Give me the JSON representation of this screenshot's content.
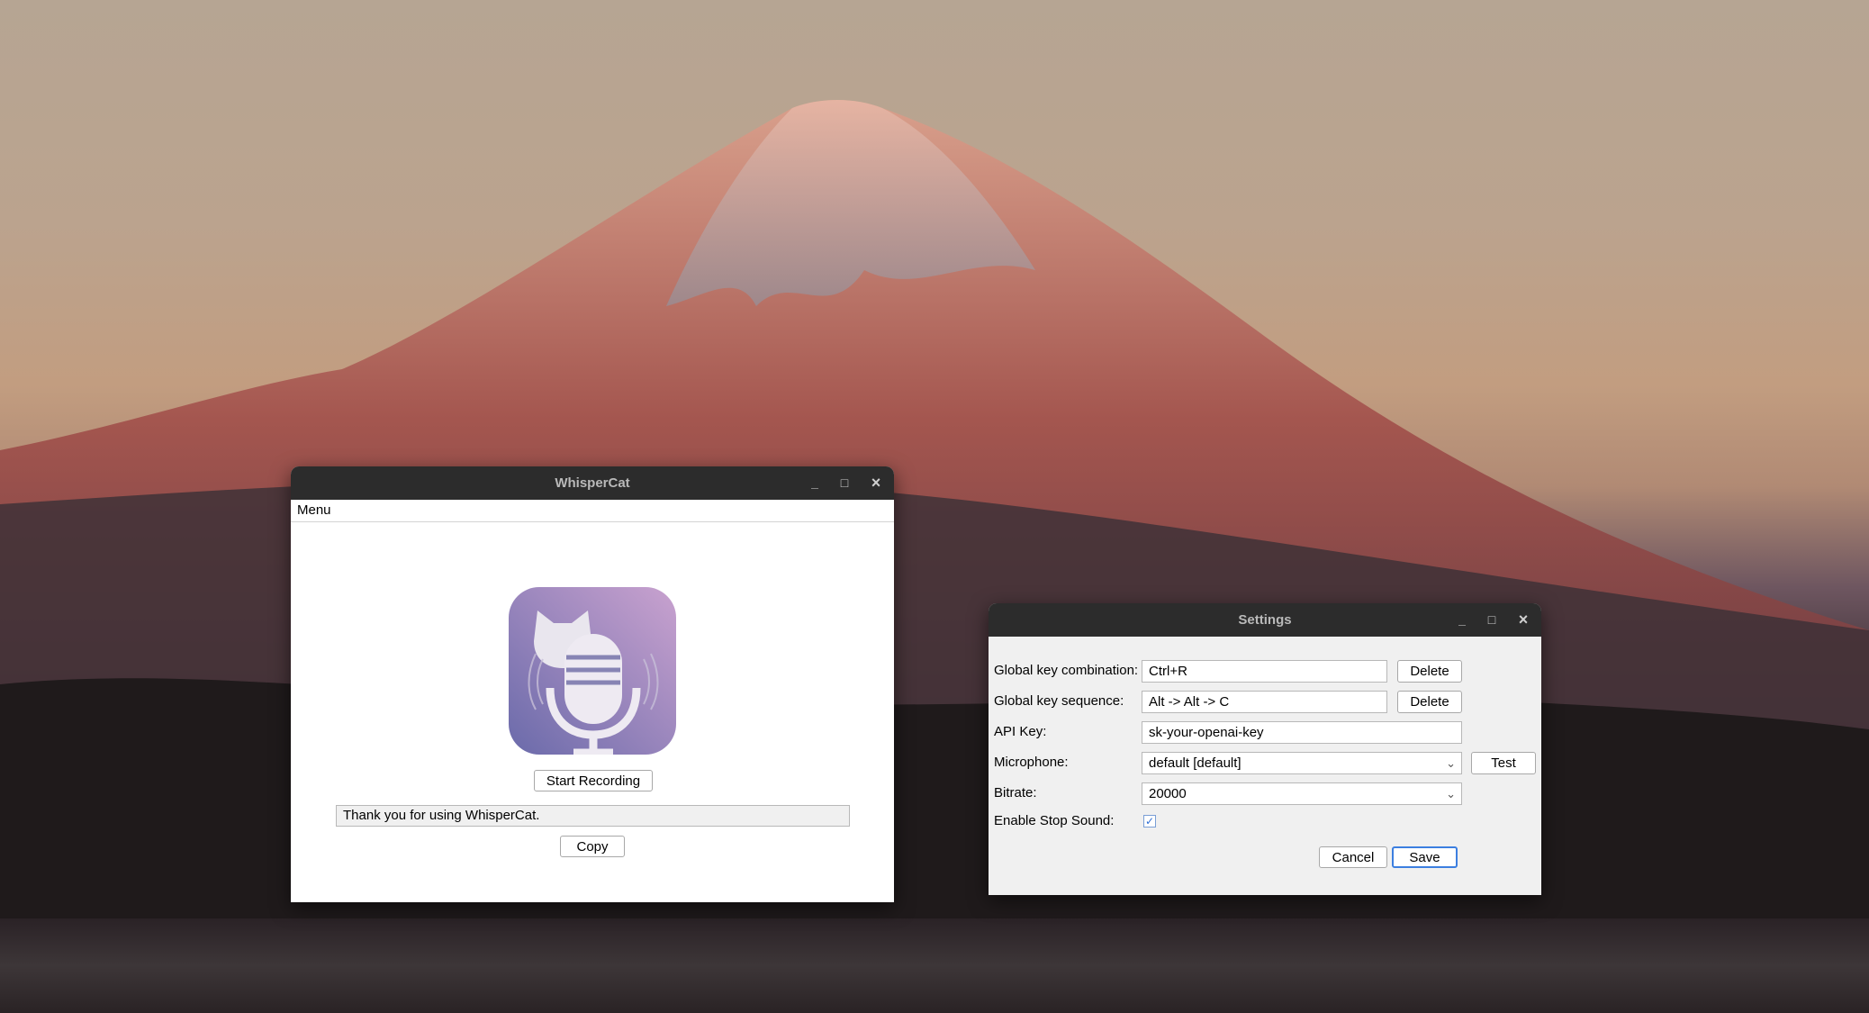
{
  "desktop": {
    "wallpaper": "mountain-at-dusk"
  },
  "main_window": {
    "title": "WhisperCat",
    "controls": {
      "minimize": "_",
      "maximize": "□",
      "close": "×"
    },
    "menu": {
      "label": "Menu"
    },
    "logo": "microphone-cat-logo",
    "record_button": "Start Recording",
    "transcript_text": "Thank you for using WhisperCat.",
    "copy_button": "Copy"
  },
  "settings_window": {
    "title": "Settings",
    "controls": {
      "minimize": "_",
      "maximize": "□",
      "close": "×"
    },
    "rows": {
      "global_key_combination": {
        "label": "Global key combination:",
        "value": "Ctrl+R",
        "button": "Delete"
      },
      "global_key_sequence": {
        "label": "Global key sequence:",
        "value": "Alt -> Alt -> C",
        "button": "Delete"
      },
      "api_key": {
        "label": "API Key:",
        "value": "sk-your-openai-key"
      },
      "microphone": {
        "label": "Microphone:",
        "value": "default [default]",
        "button": "Test"
      },
      "bitrate": {
        "label": "Bitrate:",
        "value": "20000"
      },
      "enable_stop_sound": {
        "label": "Enable Stop Sound:",
        "checked": true
      }
    },
    "cancel_button": "Cancel",
    "save_button": "Save",
    "accent_color": "#3c7fe0"
  }
}
